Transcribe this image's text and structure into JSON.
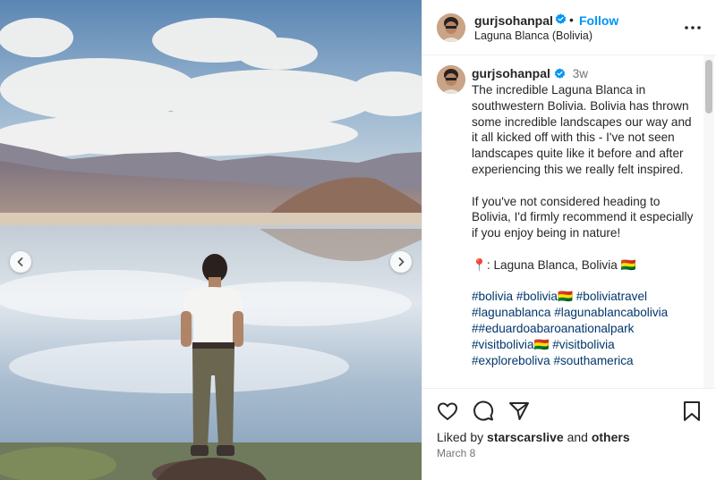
{
  "post": {
    "username": "gurjsohanpal",
    "follow_label": "Follow",
    "separator": "•",
    "location": "Laguna Blanca (Bolivia)",
    "caption_time": "3w",
    "caption_paragraph_1": "The incredible Laguna Blanca in southwestern Bolivia. Bolivia has thrown some incredible landscapes our way and it all kicked off with this - I've not seen landscapes quite like it before and after experiencing this we really felt inspired.",
    "caption_paragraph_2": "If you've not considered heading to Bolivia, I'd firmly recommend it especially if you enjoy being in nature!",
    "caption_location_line": "📍: Laguna Blanca, Bolivia 🇧🇴",
    "hashtags": [
      "#bolivia",
      "#bolivia🇧🇴",
      "#boliviatravel",
      "#lagunablanca",
      "#lagunablancabolivia",
      "##eduardoabaroanationalpark",
      "#visitbolivia🇧🇴",
      "#visitbolivia",
      "#exploreboliva",
      "#southamerica"
    ],
    "liked_by_prefix": "Liked by",
    "liked_by_user": "starscarslive",
    "liked_by_and": "and",
    "liked_by_others": "others",
    "date": "March 8"
  },
  "icons": {
    "verified": "verified-badge-icon",
    "more": "more-options-icon",
    "prev": "chevron-left-icon",
    "next": "chevron-right-icon",
    "like": "heart-icon",
    "comment": "comment-bubble-icon",
    "share": "paper-plane-icon",
    "save": "bookmark-icon"
  },
  "colors": {
    "accent": "#0095f6",
    "verified": "#0095f6",
    "hashtag": "#00376b",
    "text": "#262626",
    "muted": "#737373"
  }
}
